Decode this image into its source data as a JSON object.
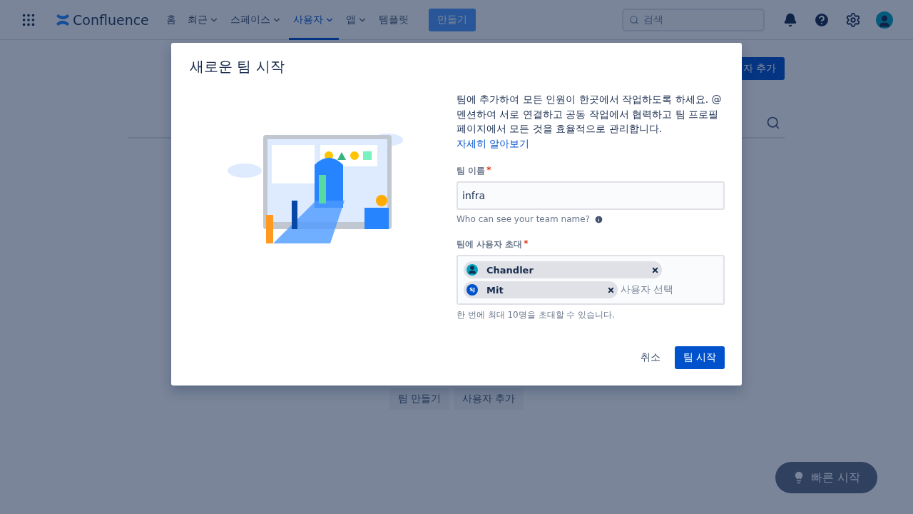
{
  "nav": {
    "product": "Confluence",
    "items": [
      {
        "label": "홈",
        "dropdown": false,
        "selected": false
      },
      {
        "label": "최근",
        "dropdown": true,
        "selected": false
      },
      {
        "label": "스페이스",
        "dropdown": true,
        "selected": false
      },
      {
        "label": "사용자",
        "dropdown": true,
        "selected": true
      },
      {
        "label": "앱",
        "dropdown": true,
        "selected": false
      },
      {
        "label": "템플릿",
        "dropdown": false,
        "selected": false
      }
    ],
    "create": "만들기",
    "search": {
      "placeholder": "검색"
    }
  },
  "page": {
    "header_button": "자 추가",
    "actions": [
      "팀 만들기",
      "사용자 추가"
    ],
    "quick_start": "빠른 시작"
  },
  "dialog": {
    "title": "새로운 팀 시작",
    "intro": "팀에 추가하여 모든 인원이 한곳에서 작업하도록 하세요. @멘션하여 서로 연결하고 공동 작업에서 협력하고 팀 프로필 페이지에서 모든 것을 효율적으로 관리합니다.",
    "learn_more": "자세히 알아보기",
    "team_name": {
      "label": "팀 이름",
      "required_mark": "*",
      "value": "infra",
      "help": "Who can see your team name?"
    },
    "invite": {
      "label": "팀에 사용자 초대",
      "required_mark": "*",
      "placeholder": "사용자 선택",
      "help": "한 번에 최대 10명을 초대할 수 있습니다.",
      "users": [
        {
          "name": "Chandler",
          "kind": "silhouette"
        },
        {
          "name": "Mit",
          "kind": "initials",
          "initials": "SJ"
        }
      ]
    },
    "cancel": "취소",
    "submit": "팀 시작"
  }
}
